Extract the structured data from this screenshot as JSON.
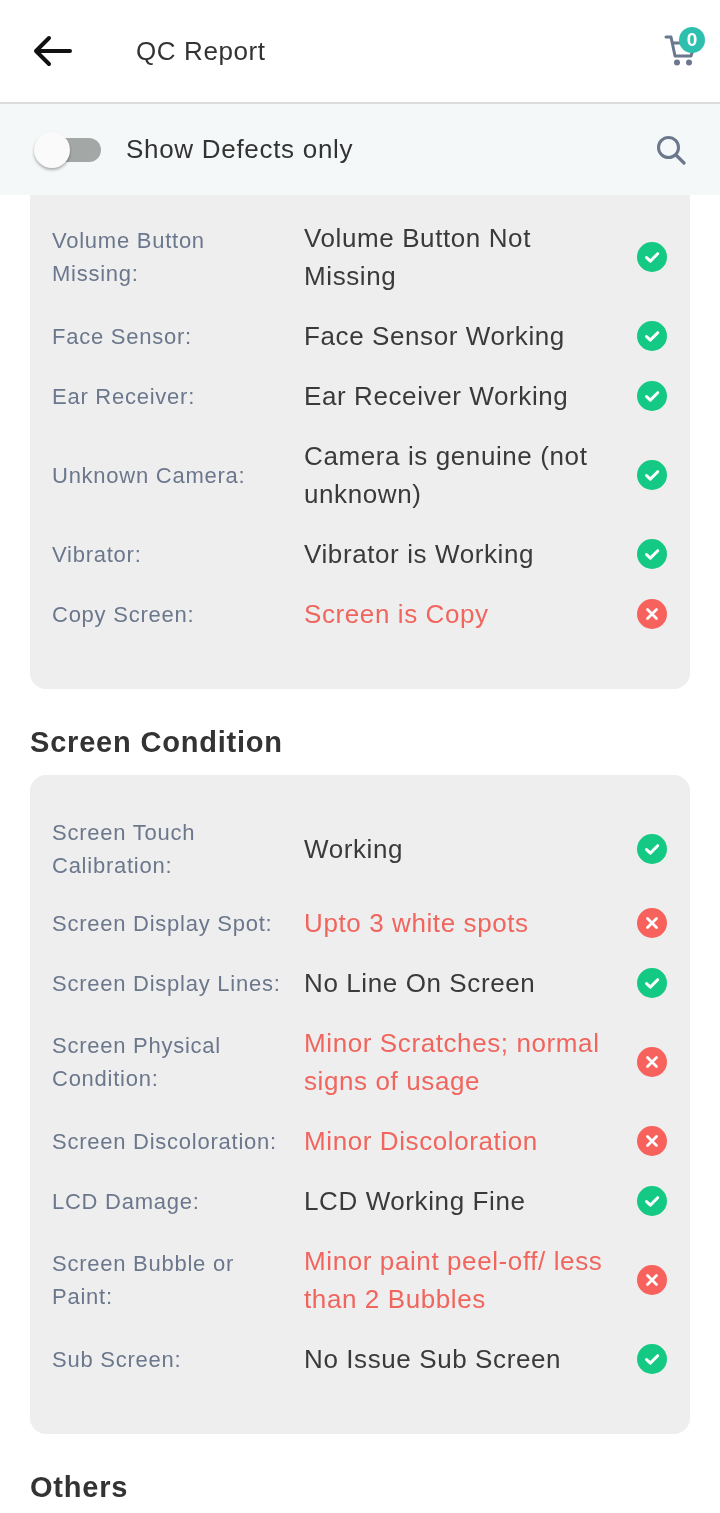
{
  "header": {
    "title": "QC Report",
    "cart_count": "0"
  },
  "filter": {
    "label": "Show Defects only",
    "on": false
  },
  "sections": [
    {
      "items": [
        {
          "label": "Volume Button Missing:",
          "value": "Volume Button Not Missing",
          "passed": true
        },
        {
          "label": "Face Sensor:",
          "value": "Face Sensor Working",
          "passed": true
        },
        {
          "label": "Ear Receiver:",
          "value": "Ear Receiver Working",
          "passed": true
        },
        {
          "label": "Unknown Camera:",
          "value": "Camera is genuine (not unknown)",
          "passed": true
        },
        {
          "label": "Vibrator:",
          "value": "Vibrator is Working",
          "passed": true
        },
        {
          "label": "Copy Screen:",
          "value": "Screen is Copy",
          "passed": false
        }
      ]
    },
    {
      "title": "Screen Condition",
      "items": [
        {
          "label": "Screen Touch Calibration:",
          "value": "Working",
          "passed": true
        },
        {
          "label": "Screen Display Spot:",
          "value": "Upto 3 white spots",
          "passed": false
        },
        {
          "label": "Screen Display Lines:",
          "value": "No Line On Screen",
          "passed": true
        },
        {
          "label": "Screen Physical Condition:",
          "value": "Minor Scratches; normal signs of usage",
          "passed": false
        },
        {
          "label": "Screen Discoloration:",
          "value": "Minor Discoloration",
          "passed": false
        },
        {
          "label": "LCD Damage:",
          "value": "LCD Working Fine",
          "passed": true
        },
        {
          "label": "Screen Bubble or Paint:",
          "value": "Minor paint peel-off/ less than 2 Bubbles",
          "passed": false
        },
        {
          "label": "Sub Screen:",
          "value": "No Issue Sub Screen",
          "passed": true
        }
      ]
    },
    {
      "title": "Others"
    }
  ]
}
